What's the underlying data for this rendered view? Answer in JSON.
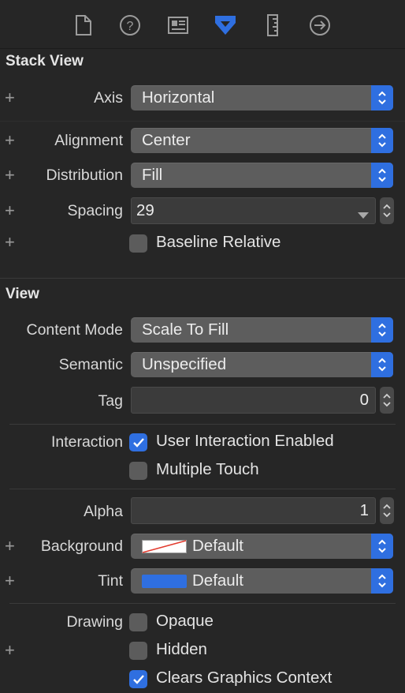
{
  "toolbar": {
    "icons": [
      "file-inspector-icon",
      "quick-help-icon",
      "identity-inspector-icon",
      "attributes-inspector-icon",
      "size-inspector-icon",
      "connections-inspector-icon"
    ]
  },
  "stack_view": {
    "title": "Stack View",
    "axis_label": "Axis",
    "axis_value": "Horizontal",
    "alignment_label": "Alignment",
    "alignment_value": "Center",
    "distribution_label": "Distribution",
    "distribution_value": "Fill",
    "spacing_label": "Spacing",
    "spacing_value": "29",
    "baseline_label": "Baseline Relative",
    "baseline_checked": false
  },
  "view": {
    "title": "View",
    "content_mode_label": "Content Mode",
    "content_mode_value": "Scale To Fill",
    "semantic_label": "Semantic",
    "semantic_value": "Unspecified",
    "tag_label": "Tag",
    "tag_value": "0",
    "interaction_label": "Interaction",
    "user_interaction_label": "User Interaction Enabled",
    "user_interaction_checked": true,
    "multiple_touch_label": "Multiple Touch",
    "multiple_touch_checked": false,
    "alpha_label": "Alpha",
    "alpha_value": "1",
    "background_label": "Background",
    "background_value": "Default",
    "tint_label": "Tint",
    "tint_value": "Default",
    "tint_color": "#2f6fe0",
    "drawing_label": "Drawing",
    "opaque_label": "Opaque",
    "opaque_checked": false,
    "hidden_label": "Hidden",
    "hidden_checked": false,
    "clears_label": "Clears Graphics Context",
    "clears_checked": true
  },
  "colors": {
    "accent": "#2f6fe0",
    "panel": "#262626",
    "popup": "#5d5d5d"
  }
}
